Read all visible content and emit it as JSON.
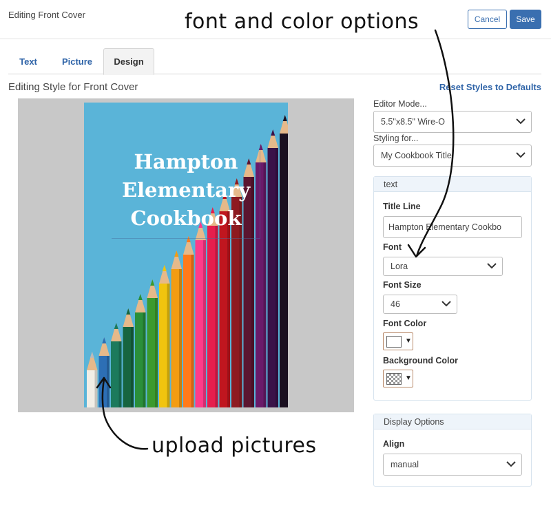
{
  "header": {
    "title": "Editing Front Cover",
    "cancel_label": "Cancel",
    "save_label": "Save"
  },
  "tabs": [
    {
      "label": "Text"
    },
    {
      "label": "Picture"
    },
    {
      "label": "Design",
      "active": true
    }
  ],
  "section": {
    "title": "Editing Style for Front Cover",
    "reset_label": "Reset Styles to Defaults"
  },
  "cover": {
    "title_lines": [
      "Hampton",
      "Elementary",
      "Cookbook"
    ],
    "background_color": "#5ab4d8"
  },
  "editor_mode": {
    "label": "Editor Mode...",
    "value": "5.5\"x8.5\" Wire-O"
  },
  "styling_for": {
    "label": "Styling for...",
    "value": "My Cookbook Title"
  },
  "text_panel": {
    "header": "text",
    "title_line_label": "Title Line",
    "title_line_value": "Hampton Elementary Cookbo",
    "font_label": "Font",
    "font_value": "Lora",
    "font_size_label": "Font Size",
    "font_size_value": "46",
    "font_color_label": "Font Color",
    "font_color": "#ffffff",
    "bg_color_label": "Background Color"
  },
  "display_panel": {
    "header": "Display Options",
    "align_label": "Align",
    "align_value": "manual"
  },
  "annotations": {
    "top": "font and color options",
    "bottom": "upload pictures"
  },
  "colors": {
    "accent": "#3a6fb0",
    "link": "#2f64a8"
  }
}
